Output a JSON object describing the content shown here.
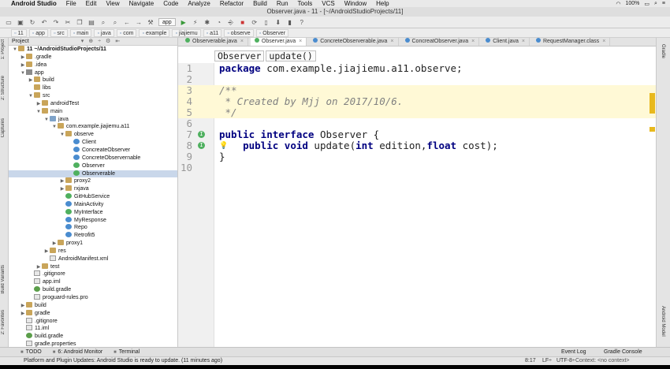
{
  "menubar": {
    "app_name": "Android Studio",
    "items": [
      "File",
      "Edit",
      "View",
      "Navigate",
      "Code",
      "Analyze",
      "Refactor",
      "Build",
      "Run",
      "Tools",
      "VCS",
      "Window",
      "Help"
    ],
    "battery": "100%"
  },
  "window": {
    "title": "Observer.java - 11 - [~/AndroidStudioProjects/11]"
  },
  "toolbar": {
    "run_config": "app"
  },
  "navbar": {
    "crumbs": [
      "11",
      "app",
      "src",
      "main",
      "java",
      "com",
      "example",
      "jiajiemu",
      "a11",
      "observe",
      "Observer"
    ]
  },
  "left_strip": {
    "project": "1: Project",
    "structure": "2: Structure",
    "captures": "Captures",
    "build_variants": "Build Variants",
    "favorites": "2: Favorites"
  },
  "right_strip": {
    "gradle": "Gradle",
    "android_model": "Android Model"
  },
  "project_panel": {
    "view_selector": "Project",
    "tree": [
      {
        "label": "11  ~/AndroidStudioProjects/11",
        "arrow": "▼",
        "icon": "folder",
        "indent": 0,
        "bold_prefix": "11"
      },
      {
        "label": ".gradle",
        "arrow": "▶",
        "icon": "folder",
        "indent": 1
      },
      {
        "label": ".idea",
        "arrow": "▶",
        "icon": "folder",
        "indent": 1
      },
      {
        "label": "app",
        "arrow": "▼",
        "icon": "mod",
        "indent": 1
      },
      {
        "label": "build",
        "arrow": "▶",
        "icon": "folder",
        "indent": 2
      },
      {
        "label": "libs",
        "arrow": "",
        "icon": "folder",
        "indent": 2
      },
      {
        "label": "src",
        "arrow": "▼",
        "icon": "folder",
        "indent": 2
      },
      {
        "label": "androidTest",
        "arrow": "▶",
        "icon": "folder",
        "indent": 3
      },
      {
        "label": "main",
        "arrow": "▼",
        "icon": "folder",
        "indent": 3
      },
      {
        "label": "java",
        "arrow": "▼",
        "icon": "src",
        "indent": 4
      },
      {
        "label": "com.example.jiajiemu.a11",
        "arrow": "▼",
        "icon": "folder",
        "indent": 5
      },
      {
        "label": "observe",
        "arrow": "▼",
        "icon": "folder",
        "indent": 6
      },
      {
        "label": "Client",
        "arrow": "",
        "icon": "java-c",
        "indent": 7
      },
      {
        "label": "ConcreateObserver",
        "arrow": "",
        "icon": "java-c",
        "indent": 7
      },
      {
        "label": "ConcreteObservernable",
        "arrow": "",
        "icon": "java-c",
        "indent": 7
      },
      {
        "label": "Observer",
        "arrow": "",
        "icon": "java-i",
        "indent": 7
      },
      {
        "label": "Observerable",
        "arrow": "",
        "icon": "java-i",
        "indent": 7,
        "selected": true
      },
      {
        "label": "proxy2",
        "arrow": "▶",
        "icon": "folder",
        "indent": 6
      },
      {
        "label": "rxjava",
        "arrow": "▶",
        "icon": "folder",
        "indent": 6
      },
      {
        "label": "GitHubService",
        "arrow": "",
        "icon": "java-i",
        "indent": 6
      },
      {
        "label": "MainActivity",
        "arrow": "",
        "icon": "java-c",
        "indent": 6
      },
      {
        "label": "MyInterface",
        "arrow": "",
        "icon": "java-i",
        "indent": 6
      },
      {
        "label": "MyResponse",
        "arrow": "",
        "icon": "java-c",
        "indent": 6
      },
      {
        "label": "Repo",
        "arrow": "",
        "icon": "java-c",
        "indent": 6
      },
      {
        "label": "Retrofit5",
        "arrow": "",
        "icon": "java-c",
        "indent": 6
      },
      {
        "label": "proxy1",
        "arrow": "▶",
        "icon": "folder",
        "indent": 5
      },
      {
        "label": "res",
        "arrow": "▶",
        "icon": "folder",
        "indent": 4
      },
      {
        "label": "AndroidManifest.xml",
        "arrow": "",
        "icon": "file",
        "indent": 4
      },
      {
        "label": "test",
        "arrow": "▶",
        "icon": "folder",
        "indent": 3
      },
      {
        "label": ".gitignore",
        "arrow": "",
        "icon": "file",
        "indent": 2
      },
      {
        "label": "app.iml",
        "arrow": "",
        "icon": "file",
        "indent": 2
      },
      {
        "label": "build.gradle",
        "arrow": "",
        "icon": "gradle",
        "indent": 2
      },
      {
        "label": "proguard-rules.pro",
        "arrow": "",
        "icon": "file",
        "indent": 2
      },
      {
        "label": "build",
        "arrow": "▶",
        "icon": "folder",
        "indent": 1
      },
      {
        "label": "gradle",
        "arrow": "▶",
        "icon": "folder",
        "indent": 1
      },
      {
        "label": ".gitignore",
        "arrow": "",
        "icon": "file",
        "indent": 1
      },
      {
        "label": "11.iml",
        "arrow": "",
        "icon": "file",
        "indent": 1
      },
      {
        "label": "build.gradle",
        "arrow": "",
        "icon": "gradle",
        "indent": 1
      },
      {
        "label": "gradle.properties",
        "arrow": "",
        "icon": "file",
        "indent": 1
      }
    ]
  },
  "editor": {
    "tabs": [
      {
        "label": "Observerable.java",
        "kind": "i",
        "active": false
      },
      {
        "label": "Observer.java",
        "kind": "i",
        "active": true
      },
      {
        "label": "ConcreteObserverable.java",
        "kind": "c",
        "active": false
      },
      {
        "label": "ConcreatObserver.java",
        "kind": "c",
        "active": false
      },
      {
        "label": "Client.java",
        "kind": "c",
        "active": false
      },
      {
        "label": "RequestManager.class",
        "kind": "c",
        "active": false
      }
    ],
    "crumbs": [
      "Observer",
      "update()"
    ],
    "lines": [
      {
        "n": "1",
        "html": "<span class=\"kw\">package</span> com.example.jiajiemu.a11.observe;"
      },
      {
        "n": "2",
        "html": ""
      },
      {
        "n": "3",
        "html": "<span class=\"cm\">/**</span>",
        "doc": true
      },
      {
        "n": "4",
        "html": "<span class=\"cm\"> * Created by Mjj on 2017/10/6.</span>",
        "doc": true
      },
      {
        "n": "5",
        "html": "<span class=\"cm\"> */</span>",
        "doc": true
      },
      {
        "n": "6",
        "html": ""
      },
      {
        "n": "7",
        "html": "<span class=\"kw\">public interface</span> Observer {",
        "mark": "I"
      },
      {
        "n": "8",
        "html": "    <span class=\"kw\">public void</span> update(<span class=\"kw\">int</span> edition,<span class=\"kw\">float</span> cost);",
        "mark": "I",
        "bulb": true
      },
      {
        "n": "9",
        "html": "}"
      },
      {
        "n": "10",
        "html": ""
      }
    ]
  },
  "tool_windows": {
    "left": [
      "TODO",
      "6: Android Monitor",
      "Terminal"
    ],
    "right": [
      "Event Log",
      "Gradle Console"
    ]
  },
  "status": {
    "message": "Platform and Plugin Updates: Android Studio is ready to update. (11 minutes ago)",
    "position": "8:17",
    "line_sep": "LF÷",
    "encoding": "UTF-8÷",
    "context": "Context: <no context>"
  }
}
